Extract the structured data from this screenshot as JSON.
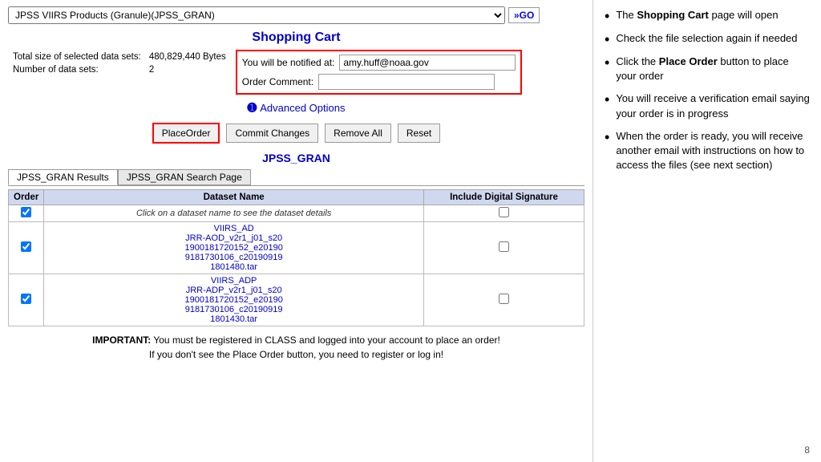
{
  "topbar": {
    "select_value": "JPSS VIIRS Products (Granule)(JPSS_GRAN)",
    "go_label": "»GO"
  },
  "cart": {
    "title": "Shopping Cart",
    "total_label": "Total size of selected data sets:",
    "total_value": "480,829,440 Bytes",
    "num_label": "Number of data sets:",
    "num_value": "2",
    "notify_label": "You will be notified at:",
    "notify_value": "amy.huff@noaa.gov",
    "comment_label": "Order Comment:",
    "comment_value": "",
    "advanced_label": "Advanced Options",
    "btn_place_order": "PlaceOrder",
    "btn_commit": "Commit Changes",
    "btn_remove": "Remove All",
    "btn_reset": "Reset",
    "gran_title": "JPSS_GRAN",
    "tab1": "JPSS_GRAN Results",
    "tab2": "JPSS_GRAN Search Page"
  },
  "table": {
    "headers": [
      "Order",
      "Dataset Name",
      "Include Digital Signature"
    ],
    "click_hint": "Click on a dataset name to see the dataset details",
    "rows": [
      {
        "checked": true,
        "dataset_group": "VIIRS_AD",
        "dataset_name": "JRR-AOD_v2r1_j01_s20\n1900181720152_e20190\n9181730106_c20190919\n1801480.tar",
        "signature": false
      },
      {
        "checked": true,
        "dataset_group": "VIIRS_ADP",
        "dataset_name": "JRR-ADP_v2r1_j01_s20\n1900181720152_e20190\n9181730106_c20190919\n1801430.tar",
        "signature": false
      }
    ]
  },
  "important": {
    "text1": "IMPORTANT: You must be registered in CLASS and logged into your account to place an order!",
    "text2": "If you don't see the Place Order button, you need to register or log in!"
  },
  "bullets": [
    {
      "text": "The <strong>Shopping Cart</strong> page will open"
    },
    {
      "text": "Check the file selection again if needed"
    },
    {
      "text": "Click the <strong>Place Order</strong> button to place your order"
    },
    {
      "text": "You will receive a verification email saying your order is in progress"
    },
    {
      "text": "When the order is ready, you will receive another email with instructions on how to access the files (see next section)"
    }
  ],
  "page_number": "8"
}
